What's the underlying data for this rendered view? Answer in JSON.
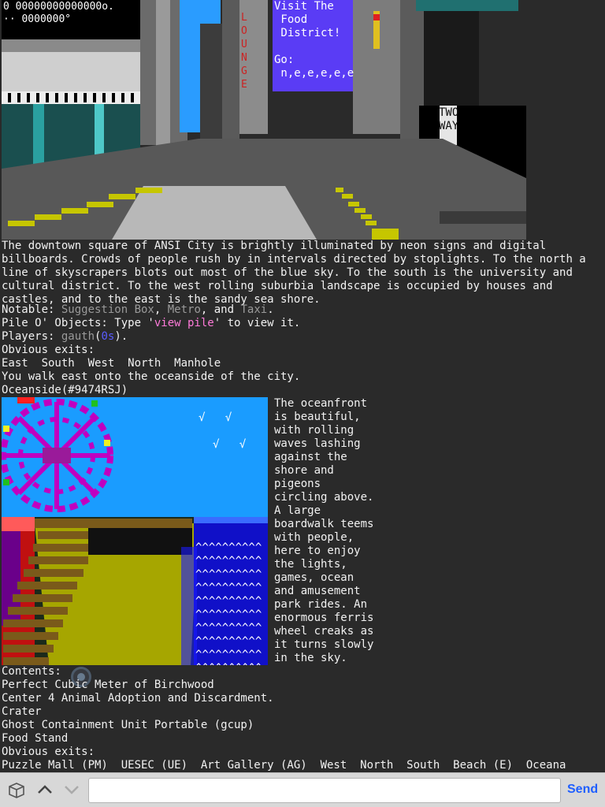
{
  "art_top": {
    "score_line": "0  00000000000000o.",
    "score_line2": " ··  0000000°",
    "sign_visit": "Visit The\n Food\n District!\n\nGo:\n n,e,e,e,e,e",
    "sign_lounge": "LOUNGE",
    "sign_twoway": "TWO\nWAY"
  },
  "description": "The downtown square of ANSI City is brightly illuminated by neon signs and digital billboards. Crowds of people rush by in intervals directed by stoplights. To the north a line of skyscrapers blots out most of the blue sky. To the south is the university and cultural district. To the west rolling suburbia landscape is occupied by houses and castles, and to the east is the sandy sea shore.",
  "notable": {
    "prefix": "Notable: ",
    "items": [
      "Suggestion Box",
      "Metro",
      "Taxi"
    ],
    "sep1": ", ",
    "sep2": ", and ",
    "suffix": "."
  },
  "pile": {
    "prefix": "Pile O' Objects: Type '",
    "cmd": "view pile",
    "suffix": "' to view it."
  },
  "players": {
    "prefix": "Players: ",
    "name": "gauth",
    "open": "(",
    "idle": "0s",
    "close": ")."
  },
  "exits1": {
    "label": "Obvious exits:",
    "list": "East  South  West  North  Manhole"
  },
  "walk_msg": "You walk east onto the oceanside of the city.",
  "room_name": "Oceanside(#9474RSJ)",
  "ocean_desc": "The oceanfront\nis beautiful,\nwith rolling\nwaves lashing\nagainst the\nshore and\npigeons\ncircling above.\nA large\nboardwalk teems\nwith people,\nhere to enjoy\nthe lights,\ngames, ocean\nand amusement\npark rides. An\nenormous ferris\nwheel creaks as\nit turns slowly\nin the sky.",
  "birds": "√   √\n\n  √   √",
  "waves": "^^^^^^^^^^",
  "contents": {
    "label": "Contents:",
    "items": [
      "Perfect Cubic Meter of Birchwood",
      "Center 4 Animal Adoption and Discardment.",
      "Crater",
      "Ghost Containment Unit Portable (gcup)",
      "Food Stand"
    ]
  },
  "exits2": {
    "label": "Obvious exits:",
    "list": "Puzzle Mall (PM)  UESEC (UE)  Art Gallery (AG)  West  North  South  Beach (E)  Oceana"
  },
  "input_bar": {
    "placeholder": "",
    "send_label": "Send",
    "icons": [
      "box-icon",
      "up-arrow-icon",
      "down-arrow-icon"
    ]
  }
}
